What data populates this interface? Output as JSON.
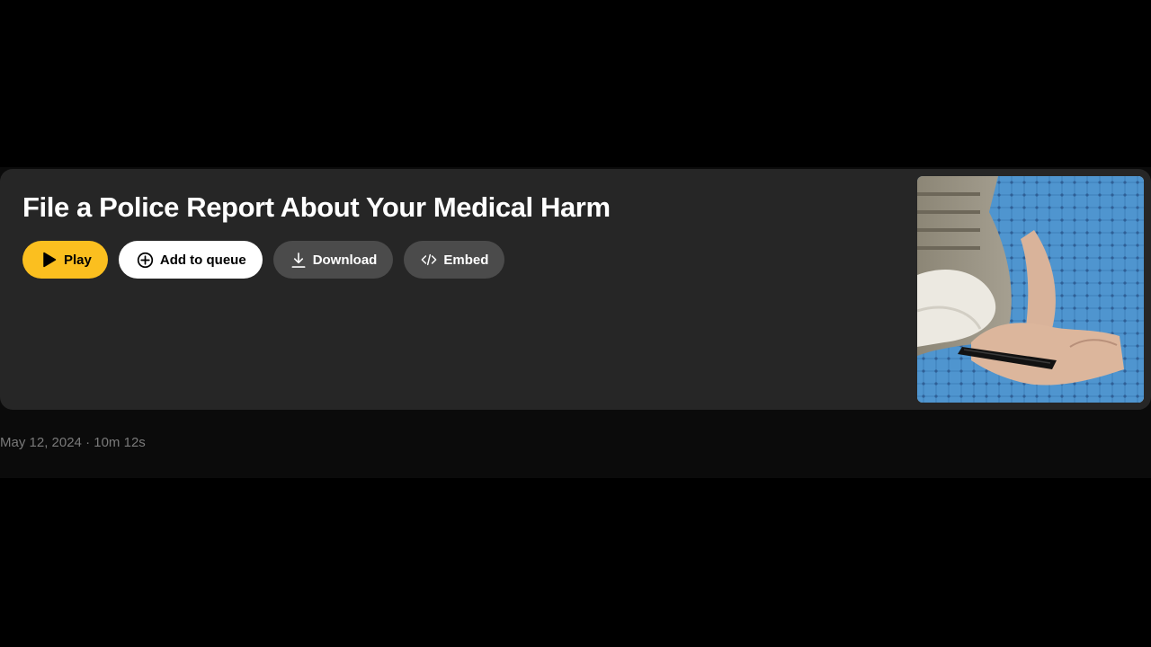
{
  "episode": {
    "title": "File a Police Report About Your Medical Harm",
    "date": "May 12, 2024",
    "separator": "·",
    "duration": "10m 12s"
  },
  "actions": {
    "play": {
      "label": "Play",
      "icon": "play-icon"
    },
    "queue": {
      "label": "Add to queue",
      "icon": "plus-circle-icon"
    },
    "download": {
      "label": "Download",
      "icon": "download-icon"
    },
    "embed": {
      "label": "Embed",
      "icon": "code-icon"
    }
  },
  "thumbnail": {
    "icon": "episode-artwork"
  },
  "colors": {
    "accent": "#fbbf1f",
    "card": "#262626",
    "secondary_button": "#4b4b4b",
    "meta_text": "#7a7a7a"
  }
}
